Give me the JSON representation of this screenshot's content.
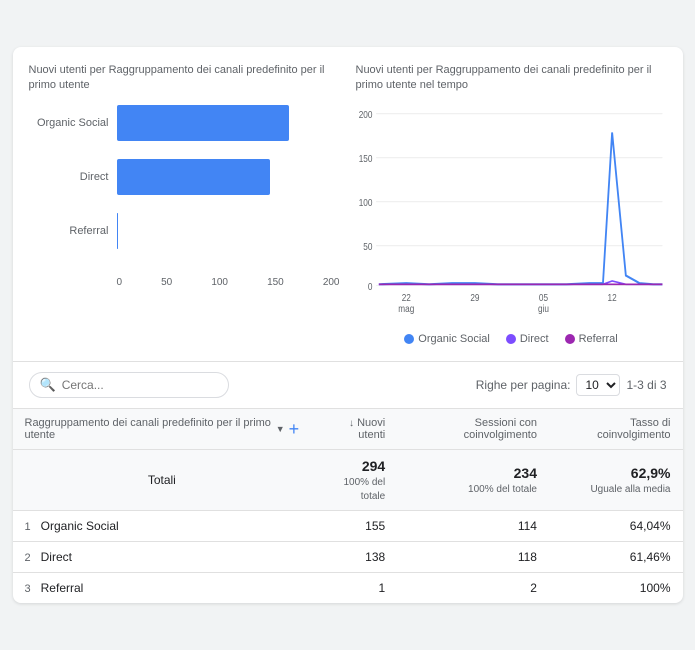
{
  "charts": {
    "left": {
      "title": "Nuovi utenti per Raggruppamento dei canali predefinito per il primo utente",
      "bars": [
        {
          "label": "Organic Social",
          "value": 155,
          "max": 200,
          "pct": 77.5
        },
        {
          "label": "Direct",
          "value": 138,
          "max": 200,
          "pct": 69
        },
        {
          "label": "Referral",
          "value": 1,
          "max": 200,
          "pct": 0.5
        }
      ],
      "xLabels": [
        "0",
        "50",
        "100",
        "150",
        "200"
      ]
    },
    "right": {
      "title": "Nuovi utenti per Raggruppamento dei canali predefinito per il primo utente nel tempo",
      "yLabels": [
        "200",
        "150",
        "100",
        "50",
        "0"
      ],
      "xLabels": [
        {
          "text": "22",
          "sub": "mag"
        },
        {
          "text": "29",
          "sub": ""
        },
        {
          "text": "05",
          "sub": "giu"
        },
        {
          "text": "12",
          "sub": ""
        }
      ]
    }
  },
  "legend": [
    {
      "label": "Organic Social",
      "color": "#4285f4"
    },
    {
      "label": "Direct",
      "color": "#7c4dff"
    },
    {
      "label": "Referral",
      "color": "#9c27b0"
    }
  ],
  "toolbar": {
    "search_placeholder": "Cerca...",
    "rows_label": "Righe per pagina:",
    "rows_value": "10",
    "page_info": "1-3 di 3"
  },
  "table": {
    "columns": [
      {
        "id": "dim",
        "label": "Raggruppamento dei canali predefinito per il primo utente",
        "sortable": false
      },
      {
        "id": "new_users",
        "label": "↓ Nuovi utenti",
        "sortable": true
      },
      {
        "id": "sessions",
        "label": "Sessioni con coinvolgimento",
        "sortable": false
      },
      {
        "id": "rate",
        "label": "Tasso di coinvolgimento",
        "sortable": false
      }
    ],
    "totals": {
      "label": "Totali",
      "new_users": "294",
      "new_users_sub": "100% del totale",
      "sessions": "234",
      "sessions_sub": "100% del totale",
      "rate": "62,9%",
      "rate_sub": "Uguale alla media"
    },
    "rows": [
      {
        "num": "1",
        "name": "Organic Social",
        "new_users": "155",
        "sessions": "114",
        "rate": "64,04%"
      },
      {
        "num": "2",
        "name": "Direct",
        "new_users": "138",
        "sessions": "118",
        "rate": "61,46%"
      },
      {
        "num": "3",
        "name": "Referral",
        "new_users": "1",
        "sessions": "2",
        "rate": "100%"
      }
    ]
  }
}
